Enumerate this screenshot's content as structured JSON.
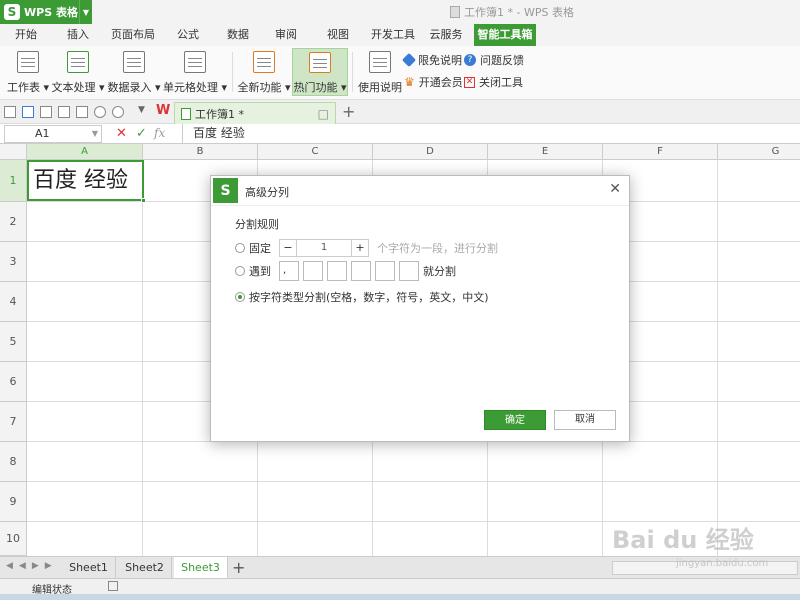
{
  "app": {
    "logo_letter": "S",
    "name": "WPS 表格",
    "window_title": "工作簿1 * - WPS 表格"
  },
  "menu_tabs": [
    "开始",
    "插入",
    "页面布局",
    "公式",
    "数据",
    "审阅",
    "视图",
    "开发工具",
    "云服务",
    "智能工具箱"
  ],
  "active_menu_tab": "智能工具箱",
  "ribbon": {
    "buttons": [
      "工作表",
      "文本处理",
      "数据录入",
      "单元格处理",
      "全新功能",
      "热门功能",
      "使用说明"
    ],
    "side_items": [
      "限免说明",
      "问题反馈",
      "开通会员",
      "关闭工具"
    ]
  },
  "document_tab": {
    "name": "工作簿1 *"
  },
  "formula_bar": {
    "cell_ref": "A1",
    "cancel": "✕",
    "confirm": "✓",
    "fx": "fx",
    "content": "百度 经验"
  },
  "grid": {
    "columns": [
      "A",
      "B",
      "C",
      "D",
      "E",
      "F",
      "G"
    ],
    "rows": [
      "1",
      "2",
      "3",
      "4",
      "5",
      "6",
      "7",
      "8",
      "9",
      "10"
    ],
    "cell_A1": "百度 经验"
  },
  "sheets": [
    "Sheet1",
    "Sheet2",
    "Sheet3"
  ],
  "active_sheet": "Sheet3",
  "status": {
    "mode": "编辑状态"
  },
  "dialog": {
    "logo_letter": "S",
    "title": "高级分列",
    "close": "✕",
    "section_title": "分割规则",
    "option_fixed": {
      "label": "固定",
      "minus": "−",
      "value": "1",
      "plus": "+",
      "hint": "个字符为一段，进行分割",
      "selected": false
    },
    "option_encounter": {
      "label": "遇到",
      "inputs": [
        ",",
        "",
        "",
        "",
        "",
        ""
      ],
      "suffix": "就分割",
      "selected": false
    },
    "option_by_type": {
      "label": "按字符类型分割(空格，数字，符号，英文，中文)",
      "selected": true
    },
    "ok_label": "确定",
    "cancel_label": "取消"
  },
  "watermark": {
    "text": "Bai du 经验",
    "sub": "jingyan.baidu.com"
  },
  "colors": {
    "accent": "#3d9b35",
    "highlight": "#cfe6c6"
  }
}
